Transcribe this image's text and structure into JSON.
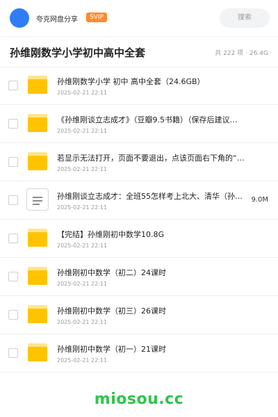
{
  "header": {
    "user_name": "夸克网盘分享",
    "badge": "SVIP",
    "search_label": "搜索"
  },
  "title_bar": {
    "title": "孙维刚数学小学初中高中全套",
    "count": "共 222 项",
    "separator": "·",
    "total_size": "26.4G"
  },
  "files": [
    {
      "type": "folder",
      "name": "孙维刚数学小学 初中 高中全套（24.6GB）",
      "date": "2025-02-21 22:11",
      "size": ""
    },
    {
      "type": "folder",
      "name": "《孙维刚谈立志成才》（豆瓣9.5书籍）（保存后建议…",
      "date": "2025-02-21 22:11",
      "size": ""
    },
    {
      "type": "folder",
      "name": "若显示无法打开，页面不要退出，点该页面右下角的“小…",
      "date": "2025-02-21 22:11",
      "size": ""
    },
    {
      "type": "doc",
      "name": "孙维刚谈立志成才：全班55怎样考上北大、清华（孙维…",
      "date": "2025-02-21 22:11",
      "size": "9.0M"
    },
    {
      "type": "folder",
      "name": "【完结】孙维刚初中数学10.8G",
      "date": "2025-02-21 22:11",
      "size": ""
    },
    {
      "type": "folder",
      "name": "孙维刚初中数学（初二）24课时",
      "date": "2025-02-21 22:11",
      "size": ""
    },
    {
      "type": "folder",
      "name": "孙维刚初中数学（初三）26课时",
      "date": "2025-02-21 22:11",
      "size": ""
    },
    {
      "type": "folder",
      "name": "孙维刚初中数学（初一）21课时",
      "date": "2025-02-21 22:11",
      "size": ""
    }
  ],
  "watermark": "miosou.cc",
  "colors": {
    "avatar": "#2f7cf6",
    "svip_badge": "#ff8a2a",
    "folder": "#ffc400",
    "watermark": "#2ec44b"
  }
}
